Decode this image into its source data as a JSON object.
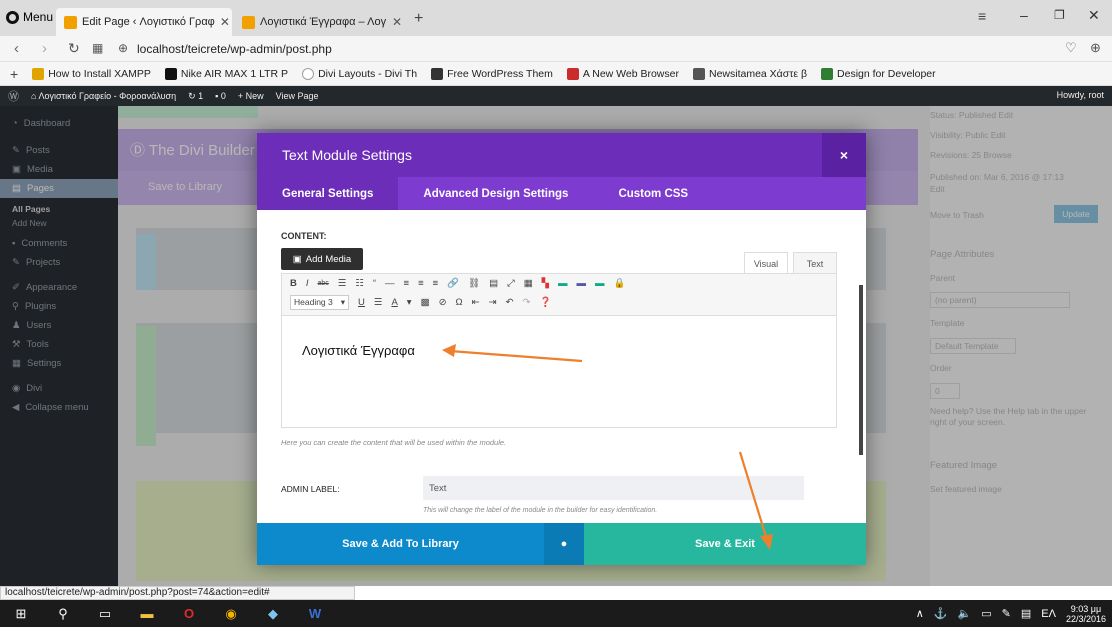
{
  "browser": {
    "menu_label": "Menu",
    "tabs": [
      {
        "title": "Edit Page ‹ Λογιστικό Γραφ"
      },
      {
        "title": "Λογιστικά Έγγραφα – Λογ"
      }
    ],
    "url": "localhost/teicrete/wp-admin/post.php",
    "bookmarks": [
      {
        "label": "How to Install XAMPP",
        "color": "#e0a400"
      },
      {
        "label": "Nike AIR MAX 1 LTR P",
        "color": "#111111"
      },
      {
        "label": "Divi Layouts - Divi Th",
        "color": "#9e9e9e"
      },
      {
        "label": "Free WordPress Them",
        "color": "#333333"
      },
      {
        "label": "A New Web Browser",
        "color": "#cc2b2b"
      },
      {
        "label": "Newsitamea Χάστε β",
        "color": "#555555"
      },
      {
        "label": "Design for Developer",
        "color": "#2e7d32"
      }
    ],
    "status_url": "localhost/teicrete/wp-admin/post.php?post=74&action=edit#"
  },
  "wp": {
    "adminbar": {
      "site": "Λογιστικό Γραφείο - Φοροανάλυση",
      "updates": "1",
      "comments": "0",
      "new_label": "New",
      "view_label": "View Page",
      "howdy": "Howdy, root"
    },
    "menu": [
      "Dashboard",
      "Posts",
      "Media",
      "Pages",
      "All Pages",
      "Add New",
      "Comments",
      "Projects",
      "Appearance",
      "Plugins",
      "Users",
      "Tools",
      "Settings",
      "Divi",
      "Collapse menu"
    ],
    "builder_title": "The Divi Builder",
    "builder_save": "Save to Library",
    "right_panel": {
      "status": "Status: Published Edit",
      "visibility": "Visibility: Public Edit",
      "revisions": "Revisions: 25 Browse",
      "published": "Published on: Mar 6, 2016 @ 17:13",
      "edit": "Edit",
      "trash": "Move to Trash",
      "update": "Update",
      "page_attributes": "Page Attributes",
      "parent": "Parent",
      "no_parent": "(no parent)",
      "template": "Template",
      "default_template": "Default Template",
      "order": "Order",
      "order_value": "0",
      "help": "Need help? Use the Help tab in the upper right of your screen.",
      "featured": "Featured Image",
      "set_featured": "Set featured image"
    }
  },
  "modal": {
    "title": "Text Module Settings",
    "close": "×",
    "tabs": [
      "General Settings",
      "Advanced Design Settings",
      "Custom CSS"
    ],
    "content_label": "CONTENT:",
    "add_media": "Add Media",
    "visual_tab": "Visual",
    "text_tab": "Text",
    "heading_select": "Heading 3",
    "editor_content": "Λογιστικά Έγγραφα",
    "content_help": "Here you can create the content that will be used within the module.",
    "admin_label": "ADMIN LABEL:",
    "admin_value": "Text",
    "admin_help": "This will change the label of the module in the builder for easy identification.",
    "save_library": "Save & Add To Library",
    "save_exit": "Save & Exit"
  },
  "taskbar": {
    "lang": "ΕΛ",
    "time": "9:03 μμ",
    "date": "22/3/2016"
  },
  "colors": {
    "modal_header": "#6c2eb9",
    "modal_tabs": "#7e3bd0",
    "save_library": "#0c8acb",
    "save_exit": "#26b79e",
    "arrow": "#ee7f2d"
  }
}
